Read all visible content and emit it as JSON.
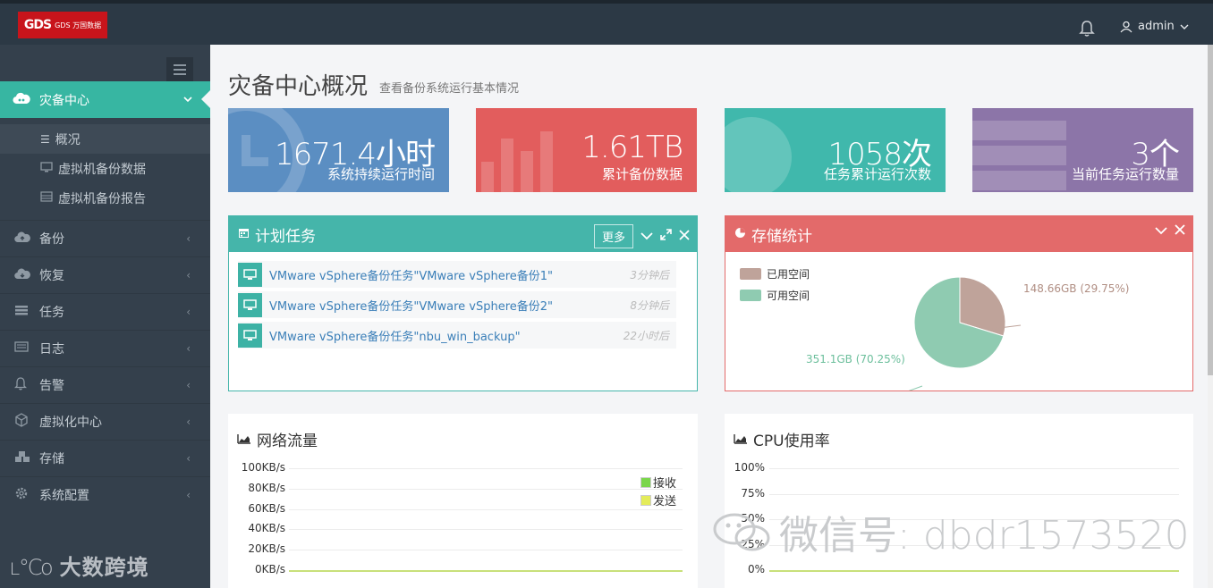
{
  "topbar": {
    "logo_text": "GDS 万国数据",
    "logo_mark": "GDS",
    "user": "admin"
  },
  "sidebar": {
    "active": {
      "label": "灾备中心",
      "icon": "cloud-icon"
    },
    "subitems": [
      {
        "label": "概况",
        "icon": "list-icon"
      },
      {
        "label": "虚拟机备份数据",
        "icon": "monitor-icon"
      },
      {
        "label": "虚拟机备份报告",
        "icon": "table-icon"
      }
    ],
    "items": [
      {
        "label": "备份",
        "icon": "cloud-upload-icon"
      },
      {
        "label": "恢复",
        "icon": "cloud-download-icon"
      },
      {
        "label": "任务",
        "icon": "tasks-icon"
      },
      {
        "label": "日志",
        "icon": "log-icon"
      },
      {
        "label": "告警",
        "icon": "bell-icon"
      },
      {
        "label": "虚拟化中心",
        "icon": "cube-icon"
      },
      {
        "label": "存储",
        "icon": "cubes-icon"
      },
      {
        "label": "系统配置",
        "icon": "gear-icon"
      }
    ],
    "watermark": "大数跨境"
  },
  "page": {
    "title": "灾备中心概况",
    "subtitle": "查看备份系统运行基本情况"
  },
  "stats": [
    {
      "value": "1671.4小时",
      "label": "系统持续运行时间",
      "color": "#5b8ec2"
    },
    {
      "value": "1.61TB",
      "label": "累计备份数据",
      "color": "#e25d5d"
    },
    {
      "value": "1058次",
      "label": "任务累计运行次数",
      "color": "#40b8ac"
    },
    {
      "value": "3个",
      "label": "当前任务运行数量",
      "color": "#8c75a8"
    }
  ],
  "tasks_panel": {
    "title": "计划任务",
    "more": "更多",
    "rows": [
      {
        "text": "VMware vSphere备份任务\"VMware vSphere备份1\"",
        "time": "3分钟后"
      },
      {
        "text": "VMware vSphere备份任务\"VMware vSphere备份2\"",
        "time": "8分钟后"
      },
      {
        "text": "VMware vSphere备份任务\"nbu_win_backup\"",
        "time": "22小时后"
      }
    ]
  },
  "storage_panel": {
    "title": "存储统计",
    "legend": [
      "已用空间",
      "可用空间"
    ],
    "used_label": "148.66GB (29.75%)",
    "free_label": "351.1GB (70.25%)"
  },
  "network_panel": {
    "title": "网络流量",
    "legend": [
      "接收",
      "发送"
    ]
  },
  "cpu_panel": {
    "title": "CPU使用率"
  },
  "watermark": "微信号: dbdr1573520",
  "chart_data": [
    {
      "type": "pie",
      "title": "存储统计",
      "categories": [
        "已用空间",
        "可用空间"
      ],
      "values": [
        148.66,
        351.1
      ],
      "labels": [
        "148.66GB (29.75%)",
        "351.1GB (70.25%)"
      ],
      "colors": [
        "#bfa39a",
        "#8fcbb1"
      ],
      "legend": "top-left"
    },
    {
      "type": "line",
      "title": "网络流量",
      "y_ticks": [
        "100KB/s",
        "80KB/s",
        "60KB/s",
        "40KB/s",
        "20KB/s",
        "0KB/s"
      ],
      "ylim": [
        0,
        100
      ],
      "series": [
        {
          "name": "接收",
          "color": "#7ad64a",
          "values": [
            0,
            0
          ]
        },
        {
          "name": "发送",
          "color": "#e4ec5a",
          "values": [
            0,
            0
          ]
        }
      ],
      "legend": "top-right"
    },
    {
      "type": "line",
      "title": "CPU使用率",
      "y_ticks": [
        "100%",
        "75%",
        "50%",
        "25%",
        "0%"
      ],
      "ylim": [
        0,
        100
      ],
      "series": [
        {
          "values": [
            0,
            0
          ],
          "color": "#c8e07a"
        }
      ]
    }
  ]
}
